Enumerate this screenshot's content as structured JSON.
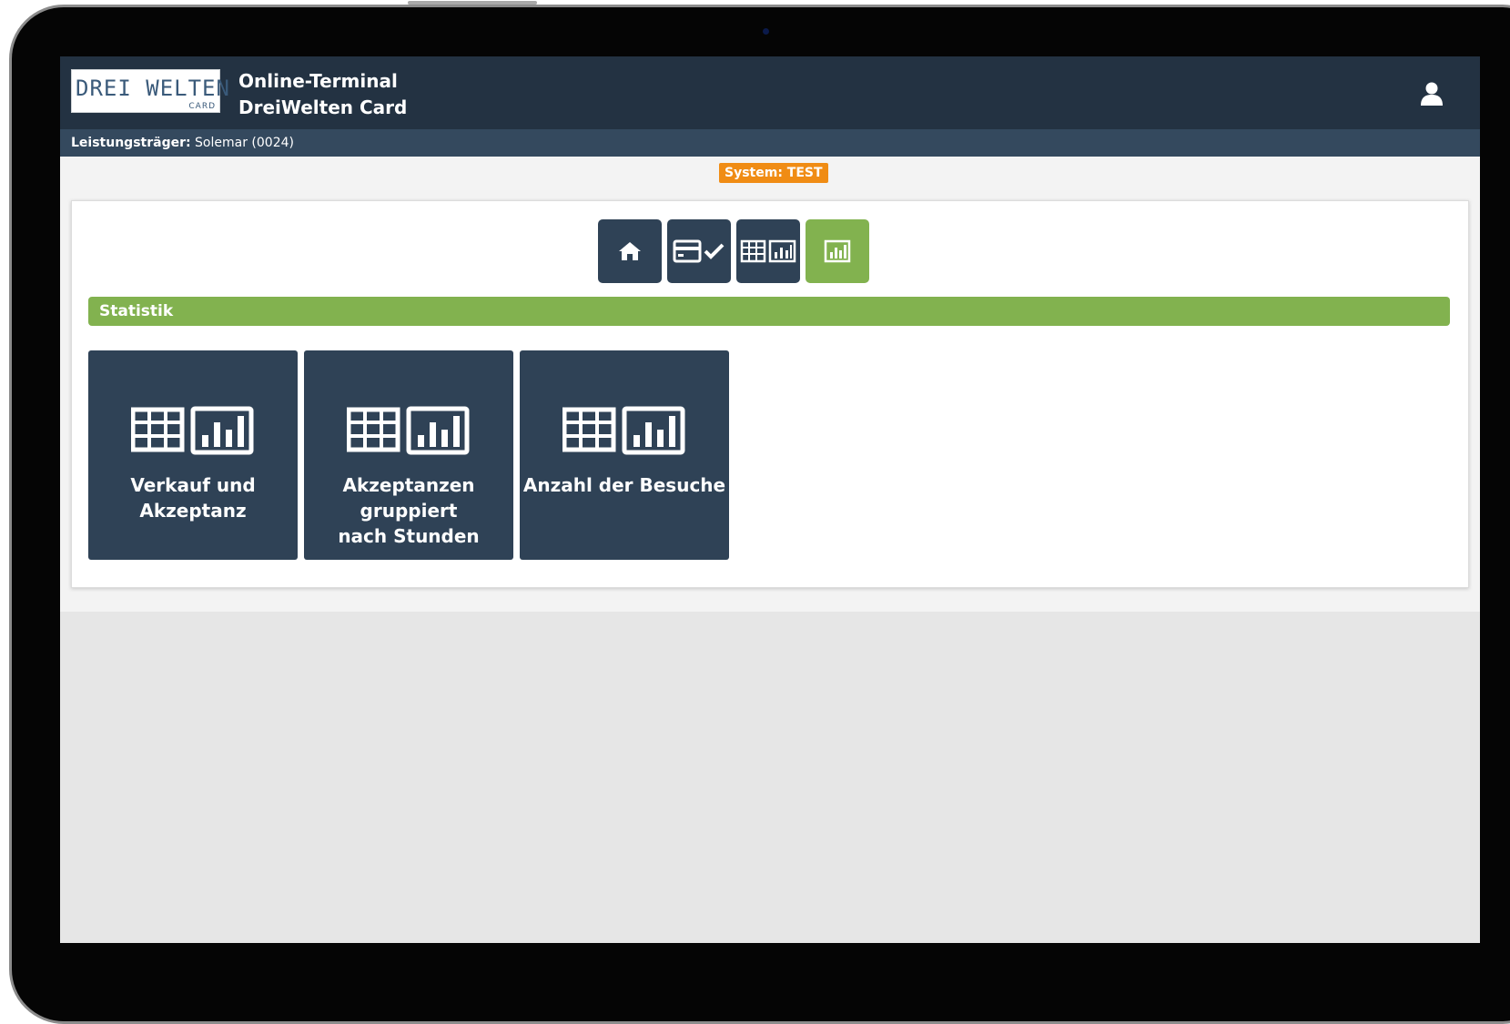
{
  "header": {
    "logo_text": "DREI WELTEN",
    "logo_sub": "CARD",
    "title_line1": "Online-Terminal",
    "title_line2": "DreiWelten Card",
    "user_icon": "user-icon"
  },
  "subheader": {
    "label": "Leistungsträger:",
    "value": "Solemar (0024)"
  },
  "system_badge": "System: TEST",
  "nav": [
    {
      "icon": "home-icon",
      "active": false
    },
    {
      "icon": "card-check-icon",
      "active": false
    },
    {
      "icon": "table-chart-icon",
      "active": false
    },
    {
      "icon": "bar-chart-icon",
      "active": true
    }
  ],
  "section_title": "Statistik",
  "tiles": [
    {
      "line1": "Verkauf und",
      "line2": "Akzeptanz",
      "line3": ""
    },
    {
      "line1": "Akzeptanzen",
      "line2": "gruppiert",
      "line3": "nach Stunden"
    },
    {
      "line1": "Anzahl der Besuche",
      "line2": "",
      "line3": ""
    }
  ],
  "colors": {
    "header": "#233242",
    "subheader": "#34495e",
    "tile": "#2f4256",
    "accent_green": "#82b24f",
    "badge": "#f08c14"
  }
}
